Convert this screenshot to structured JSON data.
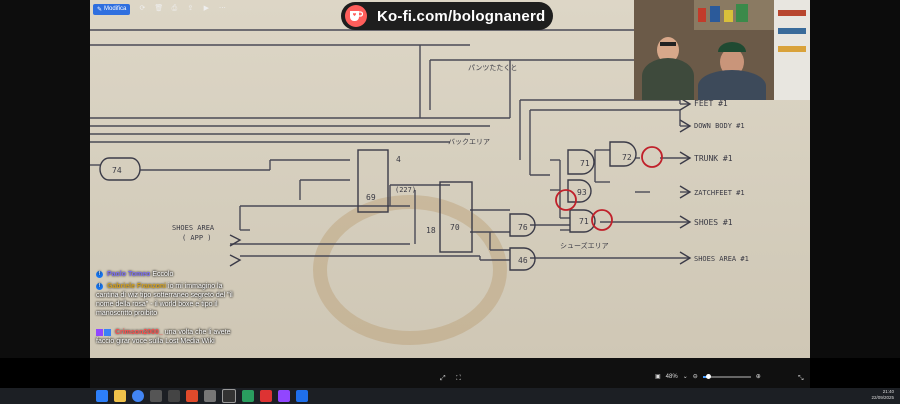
{
  "toolbar": {
    "edit_label": "Modifica"
  },
  "banner": {
    "text": "Ko-fi.com/bolognanerd"
  },
  "diagram": {
    "labels": {
      "feet1": "FEET #1",
      "down_body1": "DOWN BODY #1",
      "trunk1": "TRUNK #1",
      "zatchfeet1": "ZATCHFEET #1",
      "shoes1": "SHOES #1",
      "shoes_area1": "SHOES AREA #1",
      "shoes_area_app": "SHOES AREA",
      "app": "( APP )",
      "pantsu": "パンツたたくと",
      "back_area": "バックエリア",
      "shoes_area_jp": "シューズエリア",
      "g71": "71",
      "g72": "72",
      "g93": "93",
      "g71b": "71",
      "g76": "76",
      "g46": "46",
      "g74": "74",
      "g69": "69",
      "g70": "70",
      "n2": "2",
      "n4": "4",
      "n18": "18",
      "note_227": "(227)"
    }
  },
  "chat": {
    "messages": [
      {
        "name": "Paolo Tomeo",
        "text": "Eccolo",
        "platform": "facebook",
        "color": "#7a6df0"
      },
      {
        "name": "Gabriele Franzoni",
        "text": "io mi immagino la cantina di wiz tipo sotterraneo segreto del \"il nome della rosa\" - il world boxe e tipo il manoscritto proibito",
        "platform": "facebook",
        "color": "#d4a11e"
      },
      {
        "name": "Crimson2000_",
        "text": "una volta che li avete faccio girar voce sulla Lost Media Wiki",
        "platform": "twitch",
        "color": "#ff4d4d"
      }
    ]
  },
  "viewer": {
    "zoom": "48%",
    "zoom_level": 0.48
  },
  "clock": {
    "time": "21:40",
    "date": "22/09/2025"
  },
  "colors": {
    "kofi_red": "#ff5e5b",
    "accent": "#2f6fdf",
    "annotation_red": "#c0202a"
  }
}
